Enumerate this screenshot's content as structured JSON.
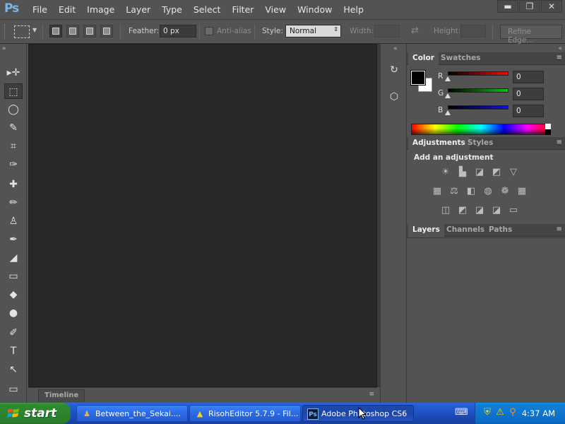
{
  "app": {
    "logo": "Ps",
    "menu": [
      "File",
      "Edit",
      "Image",
      "Layer",
      "Type",
      "Select",
      "Filter",
      "View",
      "Window",
      "Help"
    ],
    "window_controls": {
      "minimize": "▬",
      "restore": "❐",
      "close": "✕"
    }
  },
  "options_bar": {
    "feather_label": "Feather:",
    "feather_value": "0 px",
    "antialias_label": "Anti-alias",
    "style_label": "Style:",
    "style_value": "Normal",
    "width_label": "Width:",
    "swap_icon": "⇄",
    "height_label": "Height:",
    "refine_edge_label": "Refine Edge..."
  },
  "panels": {
    "collapse_left": "«",
    "collapse_right": "»",
    "color": {
      "tabs": [
        "Color",
        "Swatches"
      ],
      "menu_icon": "≡",
      "sliders": [
        {
          "label": "R",
          "value": "0",
          "color": "#e81010"
        },
        {
          "label": "G",
          "value": "0",
          "color": "#10c010"
        },
        {
          "label": "B",
          "value": "0",
          "color": "#1010e0"
        }
      ]
    },
    "adjustments": {
      "tabs": [
        "Adjustments",
        "Styles"
      ],
      "menu_icon": "≡",
      "title": "Add an adjustment",
      "icons_row1": [
        "☀",
        "▙",
        "◪",
        "◩",
        "▽"
      ],
      "icons_row2": [
        "▦",
        "⚖",
        "◧",
        "◍",
        "❁",
        "▦"
      ],
      "icons_row3": [
        "◫",
        "◩",
        "◪",
        "◪",
        "▭"
      ]
    },
    "layers": {
      "tabs": [
        "Layers",
        "Channels",
        "Paths"
      ],
      "menu_icon": "≡"
    }
  },
  "timeline": {
    "label": "Timeline",
    "menu_icon": "≡"
  },
  "tools": [
    "▸✛",
    "⬚",
    "◯",
    "✎",
    "⌗",
    "✑",
    "✚",
    "✏",
    "♙",
    "✒",
    "◢",
    "▭",
    "◆",
    "●",
    "✐",
    "T",
    "↖",
    "▭"
  ],
  "dock_icons": [
    "↻",
    "⬡"
  ],
  "taskbar": {
    "start_label": "start",
    "tasks": [
      {
        "label": "Between_the_Sekai....",
        "icon": "♟"
      },
      {
        "label": "RisohEditor 5.7.9 - Fil...",
        "icon": "▲"
      },
      {
        "label": "Adobe Photoshop CS6",
        "icon": "Ps"
      }
    ],
    "tray_icons": [
      "⌨",
      "⛨",
      "⚠",
      "⚲"
    ],
    "clock": "4:37 AM"
  }
}
